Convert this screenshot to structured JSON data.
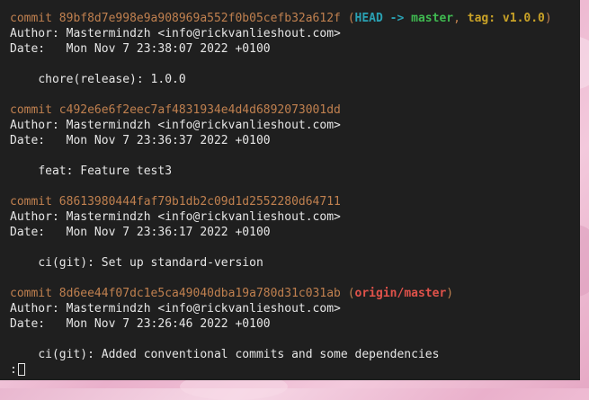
{
  "colors": {
    "terminal_bg": "#1f1f1f",
    "text": "#e6e6e6",
    "commit_hash": "#c0804f",
    "head": "#2aa1b3",
    "branch": "#3fb950",
    "tag": "#c9a227",
    "remote_branch": "#e0524a"
  },
  "labels": {
    "commit": "commit",
    "author": "Author:",
    "date": "Date:  "
  },
  "commits": [
    {
      "hash": "89bf8d7e998e9a908969a552f0b05cefb32a612f",
      "refs": {
        "head": "HEAD",
        "arrow": "->",
        "branch": "master",
        "tag": "tag: v1.0.0"
      },
      "author": "Mastermindzh <info@rickvanlieshout.com>",
      "date": "Mon Nov 7 23:38:07 2022 +0100",
      "message": "chore(release): 1.0.0"
    },
    {
      "hash": "c492e6e6f2eec7af4831934e4d4d6892073001dd",
      "author": "Mastermindzh <info@rickvanlieshout.com>",
      "date": "Mon Nov 7 23:36:37 2022 +0100",
      "message": "feat: Feature test3"
    },
    {
      "hash": "68613980444faf79b1db2c09d1d2552280d64711",
      "author": "Mastermindzh <info@rickvanlieshout.com>",
      "date": "Mon Nov 7 23:36:17 2022 +0100",
      "message": "ci(git): Set up standard-version"
    },
    {
      "hash": "8d6ee44f07dc1e5ca49040dba19a780d31c031ab",
      "refs": {
        "remote": "origin/master"
      },
      "author": "Mastermindzh <info@rickvanlieshout.com>",
      "date": "Mon Nov 7 23:26:46 2022 +0100",
      "message": "ci(git): Added conventional commits and some dependencies"
    }
  ],
  "prompt": ":"
}
